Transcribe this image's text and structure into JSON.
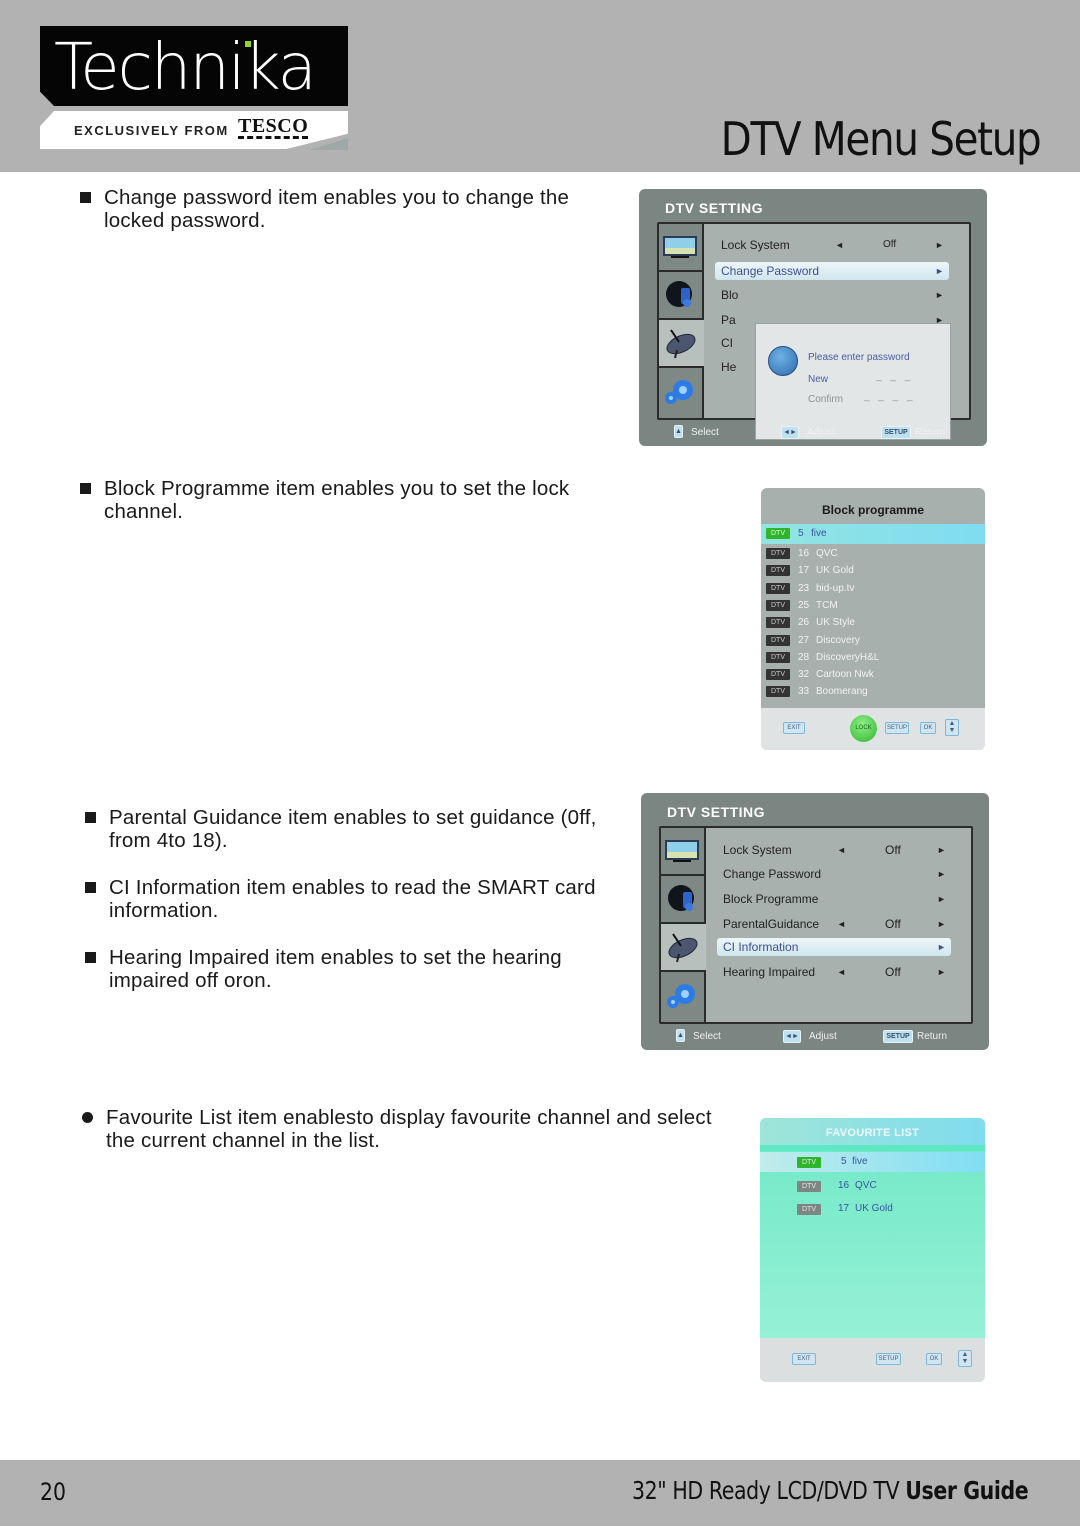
{
  "header": {
    "logo_brand": "Technika",
    "logo_tagline": "EXCLUSIVELY FROM",
    "logo_retailer": "TESCO",
    "page_title": "DTV Menu Setup"
  },
  "sections": [
    {
      "bullet": "square",
      "text": "Change password item enables you to change the locked password."
    },
    {
      "bullet": "square",
      "text": "Block Programme item enables you to set the lock channel."
    },
    {
      "bullet": "square",
      "text": "Parental Guidance item enables to set guidance (0ff, from 4to 18)."
    },
    {
      "bullet": "square",
      "text": "CI Information item enables to read the SMART card information."
    },
    {
      "bullet": "square",
      "text": "Hearing Impaired item enables to set the hearing impaired off oron."
    },
    {
      "bullet": "circle",
      "text": "Favourite List item enablesto display favourite channel and select the current channel in the list."
    }
  ],
  "dtv_setting_1": {
    "title": "DTV SETTING",
    "items": [
      {
        "label": "Lock System",
        "left_arrow": "◄",
        "value": "Off",
        "right_arrow": "►"
      },
      {
        "label": "Change Password",
        "left_arrow": "",
        "value": "",
        "right_arrow": "►",
        "selected": true
      },
      {
        "label": "Blo",
        "right_arrow": "►"
      },
      {
        "label": "Pa",
        "right_arrow": "►"
      },
      {
        "label": "CI",
        "right_arrow": "►"
      },
      {
        "label": "He",
        "right_arrow": "►"
      }
    ],
    "password_dialog": {
      "prompt": "Please enter password",
      "new_label": "New",
      "new_value": "_ _ _",
      "confirm_label": "Confirm",
      "confirm_value": "_ _ _ _"
    },
    "footer": {
      "select": "Select",
      "adjust": "Adjust",
      "setup_key": "SETUP",
      "return": "Return"
    }
  },
  "block_programme": {
    "title": "Block programme",
    "channels": [
      {
        "tag": "DTV",
        "num": "5",
        "name": "five",
        "selected": true
      },
      {
        "tag": "DTV",
        "num": "16",
        "name": "QVC"
      },
      {
        "tag": "DTV",
        "num": "17",
        "name": "UK Gold"
      },
      {
        "tag": "DTV",
        "num": "23",
        "name": "bid-up.tv"
      },
      {
        "tag": "DTV",
        "num": "25",
        "name": "TCM"
      },
      {
        "tag": "DTV",
        "num": "26",
        "name": "UK Style"
      },
      {
        "tag": "DTV",
        "num": "27",
        "name": "Discovery"
      },
      {
        "tag": "DTV",
        "num": "28",
        "name": "DiscoveryH&L"
      },
      {
        "tag": "DTV",
        "num": "32",
        "name": "Cartoon Nwk"
      },
      {
        "tag": "DTV",
        "num": "33",
        "name": "Boomerang"
      }
    ],
    "buttons": {
      "exit": "EXIT",
      "lock": "LOCK",
      "setup": "SETUP",
      "ok": "OK"
    }
  },
  "dtv_setting_2": {
    "title": "DTV SETTING",
    "items": [
      {
        "label": "Lock System",
        "left_arrow": "◄",
        "value": "Off",
        "right_arrow": "►"
      },
      {
        "label": "Change Password",
        "left_arrow": "",
        "value": "",
        "right_arrow": "►"
      },
      {
        "label": "Block Programme",
        "left_arrow": "",
        "value": "",
        "right_arrow": "►"
      },
      {
        "label": "ParentalGuidance",
        "left_arrow": "◄",
        "value": "Off",
        "right_arrow": "►"
      },
      {
        "label": "CI Information",
        "left_arrow": "",
        "value": "",
        "right_arrow": "►",
        "selected": true
      },
      {
        "label": "Hearing Impaired",
        "left_arrow": "◄",
        "value": "Off",
        "right_arrow": "►"
      }
    ],
    "footer": {
      "select": "Select",
      "adjust": "Adjust",
      "setup_key": "SETUP",
      "return": "Return"
    }
  },
  "favourite_list": {
    "title": "FAVOURITE LIST",
    "channels": [
      {
        "tag": "DTV",
        "num": "5",
        "name": "five",
        "selected": true
      },
      {
        "tag": "DTV",
        "num": "16",
        "name": "QVC"
      },
      {
        "tag": "DTV",
        "num": "17",
        "name": "UK Gold"
      }
    ],
    "buttons": {
      "exit": "EXIT",
      "setup": "SETUP",
      "ok": "OK"
    }
  },
  "footer": {
    "page_number": "20",
    "guide_prefix": "32\" HD Ready LCD/DVD TV",
    "guide_bold": "User Guide"
  },
  "icons": {
    "tab_1": "tv-picture-icon",
    "tab_2": "sound-music-icon",
    "tab_3": "satellite-dish-icon",
    "tab_4": "gear-settings-icon",
    "bullet_square": "■",
    "bullet_circle": "●",
    "arrow_left": "◄",
    "arrow_right": "►",
    "updown": "▲▼",
    "leftright": "◄►"
  },
  "colors": {
    "header_band": "#b2b2b2",
    "panel_bg": "#7b8581",
    "inner_bg": "#a8b1ae",
    "selected_text": "#3c4f92",
    "dtv_tag_selected": "#2fb42c",
    "favourite_bg": "#6ee8c6"
  }
}
